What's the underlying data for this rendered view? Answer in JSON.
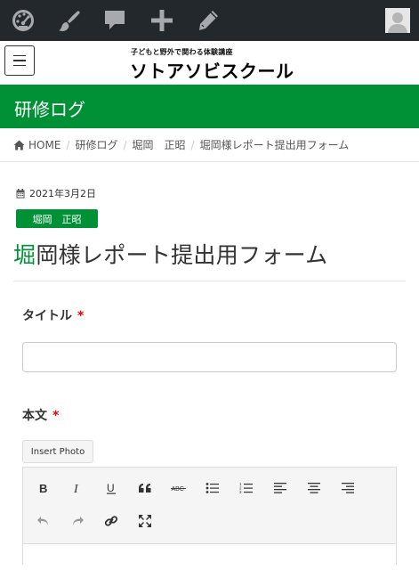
{
  "admin_bar": {
    "icons": [
      "dashboard-icon",
      "customize-brush-icon",
      "comments-icon",
      "new-content-icon",
      "edit-pencil-icon"
    ],
    "avatar": "user-avatar"
  },
  "site": {
    "tagline": "子どもと野外で関わる体験講座",
    "name": "ソトアソビスクール"
  },
  "section": {
    "title": "研修ログ"
  },
  "breadcrumb": {
    "home": "HOME",
    "items": [
      "研修ログ",
      "堀岡　正昭",
      "堀岡様レポート提出用フォーム"
    ]
  },
  "post": {
    "date": "2021年3月2日",
    "author_tag": "堀岡　正昭",
    "title_first": "堀",
    "title_rest": "岡様レポート提出用フォーム"
  },
  "form": {
    "title_label": "タイトル",
    "title_value": "",
    "body_label": "本文",
    "required_mark": "*",
    "insert_photo": "Insert Photo"
  },
  "editor_toolbar": {
    "row1": [
      "bold-icon",
      "italic-icon",
      "underline-icon",
      "blockquote-icon",
      "strikethrough-icon",
      "bullet-list-icon",
      "numbered-list-icon",
      "align-left-icon",
      "align-center-icon",
      "align-right-icon"
    ],
    "row2": [
      "undo-icon",
      "redo-icon",
      "link-icon",
      "fullscreen-icon"
    ]
  },
  "colors": {
    "accent_green": "#009137",
    "admin_bar": "#23282d",
    "required_red": "#e00000"
  }
}
